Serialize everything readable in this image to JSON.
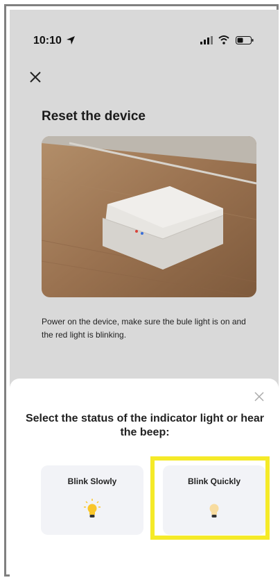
{
  "status_bar": {
    "time": "10:10"
  },
  "page": {
    "title": "Reset the device",
    "description": "Power on the device, make sure the bule light is on and the red light is blinking."
  },
  "sheet": {
    "title": "Select the status of the indicator light or hear the beep:",
    "options": [
      {
        "label": "Blink Slowly",
        "icon": "bulb-on-icon"
      },
      {
        "label": "Blink Quickly",
        "icon": "bulb-dim-icon"
      }
    ]
  },
  "colors": {
    "highlight": "#f5ea28",
    "bulb_on": "#f9c62b",
    "bulb_dim": "#f8dca0",
    "overlay": "#d9d9d9"
  }
}
